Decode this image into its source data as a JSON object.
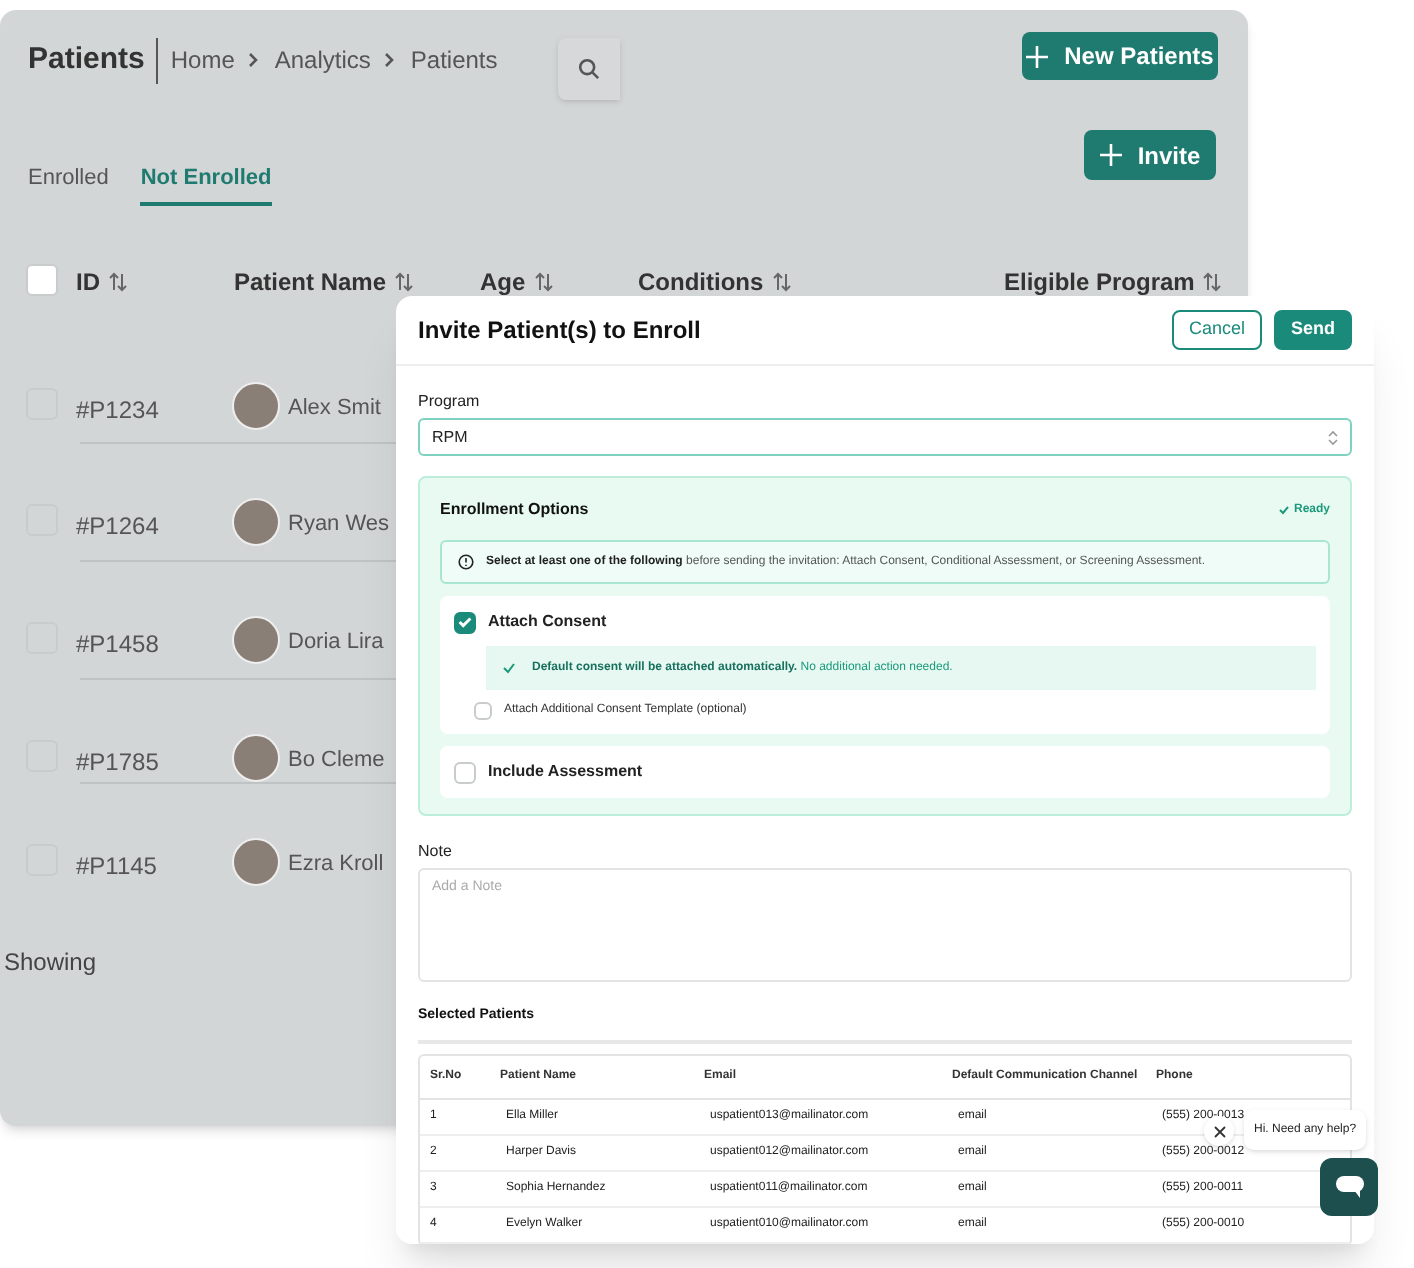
{
  "page": {
    "title": "Patients",
    "breadcrumb": [
      "Home",
      "Analytics",
      "Patients"
    ],
    "new_button": "New Patients",
    "invite_button": "Invite",
    "tabs": [
      {
        "label": "Enrolled",
        "selected": false
      },
      {
        "label": "Not Enrolled",
        "selected": true
      }
    ],
    "all_checked": false,
    "columns": [
      "ID",
      "Patient Name",
      "Age",
      "Conditions",
      "Eligible Program"
    ],
    "rows": [
      {
        "id": "#P1234",
        "name": "Alex Smit",
        "checked": false
      },
      {
        "id": "#P1264",
        "name": "Ryan Wes",
        "checked": false
      },
      {
        "id": "#P1458",
        "name": "Doria Lira",
        "checked": false
      },
      {
        "id": "#P1785",
        "name": "Bo Cleme",
        "checked": false
      },
      {
        "id": "#P1145",
        "name": "Ezra Kroll",
        "checked": false
      }
    ],
    "footer": "Showing"
  },
  "dialog": {
    "title": "Invite Patient(s) to Enroll",
    "cancel": "Cancel",
    "send": "Send",
    "program_label": "Program",
    "program_value": "RPM",
    "options_title": "Enrollment Options",
    "status": "Ready",
    "notice": "**Select at least one of the following** before sending the invitation: Attach Consent, Conditional Assessment, or Screening Assessment.",
    "options": [
      {
        "label": "Attach Consent",
        "checked": true,
        "info": "**Default consent will be attached automatically.** No additional action needed.",
        "sub_option": {
          "label": "Attach Additional Consent Template (optional)",
          "checked": false
        }
      },
      {
        "label": "Include Assessment",
        "checked": false
      }
    ],
    "note_label": "Note",
    "note_placeholder": "Add a Note",
    "selected_title": "Selected Patients",
    "columns": [
      "Sr.No",
      "Patient Name",
      "Email",
      "Default Communication Channel",
      "Phone"
    ],
    "rows": [
      [
        "1",
        "Ella Miller",
        "uspatient013@mailinator.com",
        "email",
        "(555) 200-0013"
      ],
      [
        "2",
        "Harper Davis",
        "uspatient012@mailinator.com",
        "email",
        "(555) 200-0012"
      ],
      [
        "3",
        "Sophia Hernandez",
        "uspatient011@mailinator.com",
        "email",
        "(555) 200-0011"
      ],
      [
        "4",
        "Evelyn Walker",
        "uspatient010@mailinator.com",
        "email",
        "(555) 200-0010"
      ]
    ]
  },
  "chat": {
    "message": "Hi. Need any help?"
  }
}
